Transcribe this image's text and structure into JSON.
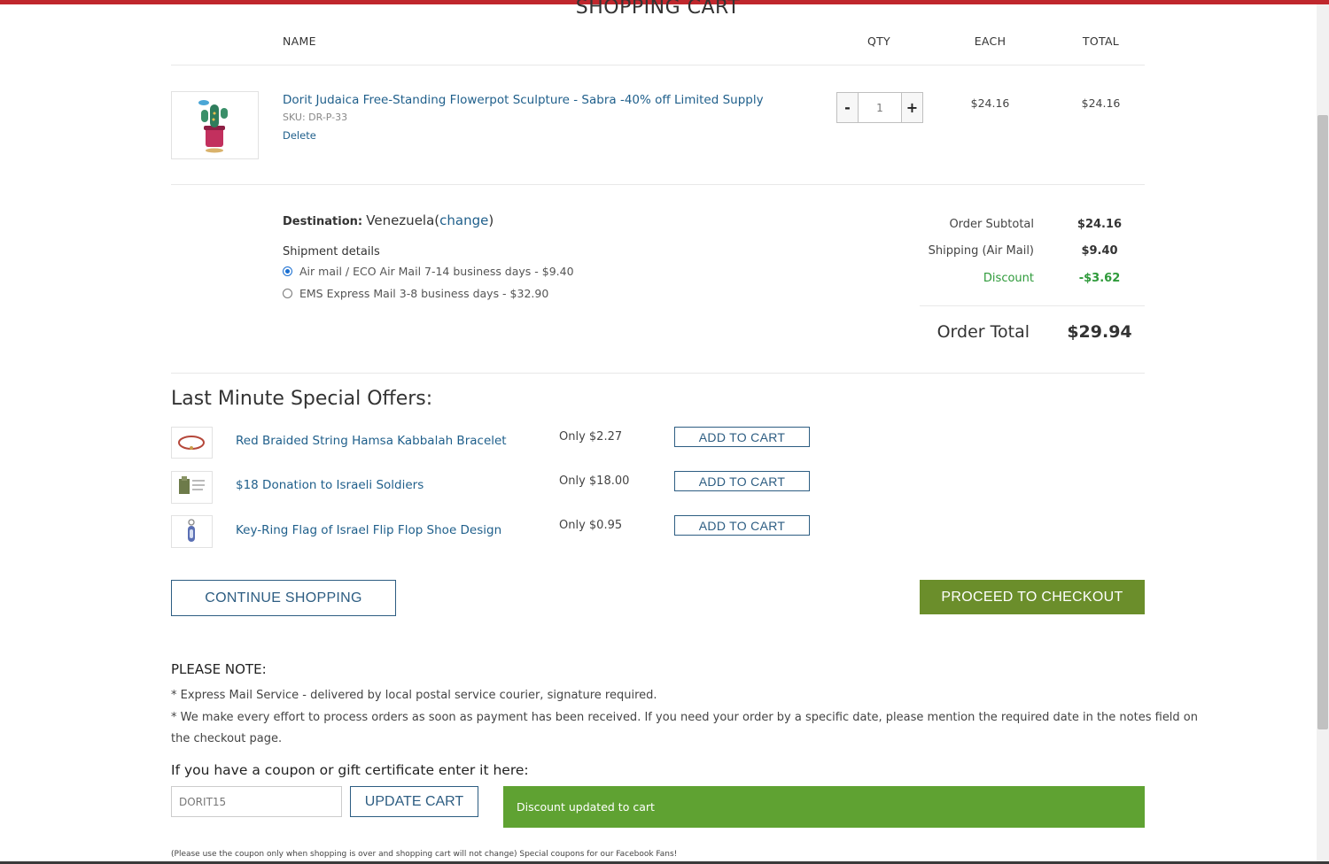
{
  "page": {
    "title": "SHOPPING CART"
  },
  "cart": {
    "headers": {
      "name": "NAME",
      "qty": "QTY",
      "each": "EACH",
      "total": "TOTAL"
    },
    "item": {
      "name": "Dorit Judaica Free-Standing Flowerpot Sculpture - Sabra -40% off Limited Supply",
      "sku": "SKU: DR-P-33",
      "delete_label": "Delete",
      "qty": "1",
      "qty_minus": "-",
      "qty_plus": "+",
      "each": "$24.16",
      "total": "$24.16"
    }
  },
  "shipping": {
    "destination_label": "Destination:",
    "destination_value": "Venezuela",
    "open_paren": "(",
    "change_label": "change",
    "close_paren": ")",
    "details_label": "Shipment details",
    "options": [
      {
        "label": "Air mail / ECO Air Mail 7-14 business days - $9.40",
        "selected": true
      },
      {
        "label": "EMS Express Mail 3-8 business days - $32.90",
        "selected": false
      }
    ]
  },
  "summary": {
    "subtotal_label": "Order Subtotal",
    "subtotal_value": "$24.16",
    "shipping_label": "Shipping (Air Mail)",
    "shipping_value": "$9.40",
    "discount_label": "Discount",
    "discount_value": "-$3.62",
    "total_label": "Order Total",
    "total_value": "$29.94",
    "discount_color": "#2e9a3a"
  },
  "offers": {
    "heading": "Last Minute Special Offers:",
    "items": [
      {
        "name": "Red Braided String Hamsa Kabbalah Bracelet",
        "price": "Only $2.27",
        "button": "ADD TO CART",
        "icon": "bracelet-icon"
      },
      {
        "name": "$18 Donation to Israeli Soldiers",
        "price": "Only $18.00",
        "button": "ADD TO CART",
        "icon": "donation-icon"
      },
      {
        "name": "Key-Ring Flag of Israel Flip Flop Shoe Design",
        "price": "Only $0.95",
        "button": "ADD TO CART",
        "icon": "keyring-icon"
      }
    ]
  },
  "actions": {
    "continue_label": "CONTINUE SHOPPING",
    "checkout_label": "PROCEED TO CHECKOUT",
    "checkout_color": "#6b8e2b"
  },
  "notes": {
    "heading": "PLEASE NOTE:",
    "line1": "* Express Mail Service - delivered by local postal service courier, signature required.",
    "line2a": "* We make every effort to process orders as soon as payment has been received. If you need your order by a specific date, please mention the required date in the notes field on",
    "line2b": "the checkout page."
  },
  "coupon": {
    "heading": "If you have a coupon or gift certificate enter it here:",
    "value": "DORIT15",
    "update_label": "UPDATE CART",
    "message": "Discount updated to cart",
    "message_color": "#5fa232",
    "footnote": "(Please use the coupon only when shopping is over and shopping cart will not change) Special coupons for our Facebook Fans!"
  },
  "colors": {
    "link": "#1f5f8b",
    "topbar": "#c0272d"
  }
}
